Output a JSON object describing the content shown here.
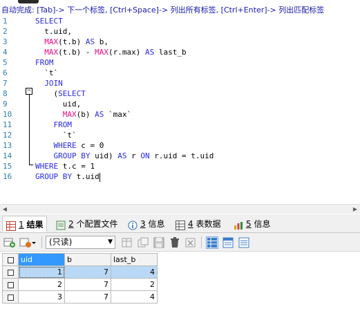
{
  "hint": "自动完成: [Tab]-> 下一个标签, [Ctrl+Space]-> 列出所有标签, [Ctrl+Enter]-> 列出匹配标签",
  "editor": {
    "lines": [
      {
        "n": "1",
        "tokens": [
          {
            "t": "SELECT",
            "c": "kw"
          }
        ]
      },
      {
        "n": "2",
        "tokens": [
          {
            "t": "  t.uid,",
            "c": ""
          }
        ]
      },
      {
        "n": "3",
        "tokens": [
          {
            "t": "  ",
            "c": ""
          },
          {
            "t": "MAX",
            "c": "fn"
          },
          {
            "t": "(t.b) ",
            "c": ""
          },
          {
            "t": "AS",
            "c": "kw"
          },
          {
            "t": " b,",
            "c": ""
          }
        ]
      },
      {
        "n": "4",
        "tokens": [
          {
            "t": "  ",
            "c": ""
          },
          {
            "t": "MAX",
            "c": "fn"
          },
          {
            "t": "(t.b) - ",
            "c": ""
          },
          {
            "t": "MAX",
            "c": "fn"
          },
          {
            "t": "(r.max) ",
            "c": ""
          },
          {
            "t": "AS",
            "c": "kw"
          },
          {
            "t": " last_b",
            "c": ""
          }
        ]
      },
      {
        "n": "5",
        "tokens": [
          {
            "t": "FROM",
            "c": "kw"
          }
        ]
      },
      {
        "n": "6",
        "tokens": [
          {
            "t": "  `t`",
            "c": ""
          }
        ]
      },
      {
        "n": "7",
        "tokens": [
          {
            "t": "  ",
            "c": ""
          },
          {
            "t": "JOIN",
            "c": "kw"
          }
        ]
      },
      {
        "n": "8",
        "tokens": [
          {
            "t": "    (",
            "c": ""
          },
          {
            "t": "SELECT",
            "c": "kw"
          }
        ]
      },
      {
        "n": "9",
        "tokens": [
          {
            "t": "      uid,",
            "c": ""
          }
        ]
      },
      {
        "n": "10",
        "tokens": [
          {
            "t": "      ",
            "c": ""
          },
          {
            "t": "MAX",
            "c": "fn"
          },
          {
            "t": "(b) ",
            "c": ""
          },
          {
            "t": "AS",
            "c": "kw"
          },
          {
            "t": " `max`",
            "c": ""
          }
        ]
      },
      {
        "n": "11",
        "tokens": [
          {
            "t": "    ",
            "c": ""
          },
          {
            "t": "FROM",
            "c": "kw"
          }
        ]
      },
      {
        "n": "12",
        "tokens": [
          {
            "t": "      `t`",
            "c": ""
          }
        ]
      },
      {
        "n": "13",
        "tokens": [
          {
            "t": "    ",
            "c": ""
          },
          {
            "t": "WHERE",
            "c": "kw"
          },
          {
            "t": " c = 0",
            "c": ""
          }
        ]
      },
      {
        "n": "14",
        "tokens": [
          {
            "t": "    ",
            "c": ""
          },
          {
            "t": "GROUP BY",
            "c": "kw"
          },
          {
            "t": " uid) ",
            "c": ""
          },
          {
            "t": "AS",
            "c": "kw"
          },
          {
            "t": " r ",
            "c": ""
          },
          {
            "t": "ON",
            "c": "kw"
          },
          {
            "t": " r.uid = t.uid",
            "c": ""
          }
        ]
      },
      {
        "n": "15",
        "tokens": [
          {
            "t": "WHERE",
            "c": "kw"
          },
          {
            "t": " t.c = 1",
            "c": ""
          }
        ]
      },
      {
        "n": "16",
        "tokens": [
          {
            "t": "GROUP BY",
            "c": "kw"
          },
          {
            "t": " t.uid",
            "c": ""
          }
        ]
      }
    ]
  },
  "tabs": [
    {
      "num": "1",
      "label": "结果",
      "icon": "grid-result-icon",
      "active": true
    },
    {
      "num": "2",
      "label": "个配置文件",
      "icon": "profile-icon",
      "active": false
    },
    {
      "num": "3",
      "label": "信息",
      "icon": "info-icon",
      "active": false
    },
    {
      "num": "4",
      "label": "表数据",
      "icon": "table-data-icon",
      "active": false
    },
    {
      "num": "5",
      "label": "信息",
      "icon": "info-chart-icon",
      "active": false
    }
  ],
  "toolbar": {
    "mode_value": "(只读)"
  },
  "grid": {
    "columns": [
      "uid",
      "b",
      "last_b"
    ],
    "rows": [
      [
        "1",
        "7",
        "4"
      ],
      [
        "2",
        "7",
        "2"
      ],
      [
        "3",
        "7",
        "4"
      ]
    ]
  }
}
